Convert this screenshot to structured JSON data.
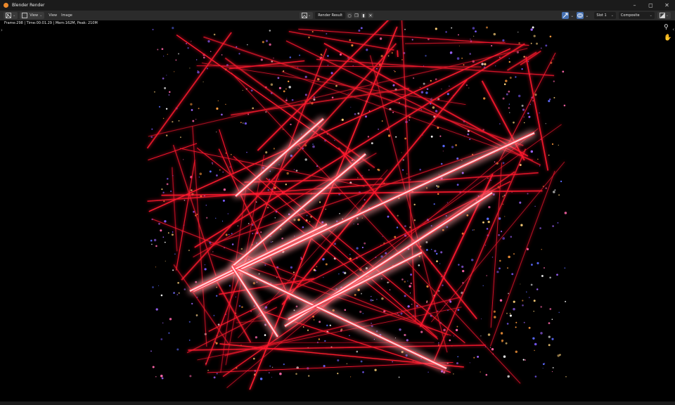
{
  "window": {
    "title": "Blender Render"
  },
  "header": {
    "view_menu": "View",
    "view_label": "View",
    "image_label": "Image",
    "result_name": "Render Result",
    "slot": "Slot 1",
    "pass": "Composite"
  },
  "viewport": {
    "info": "Frame:298 | Time:00:01.29 | Mem:162M, Peak: 210M"
  },
  "colors": {
    "laser": "#ff1a2e",
    "laser_core": "#ffd0d6",
    "header_bg": "#2b2b2b",
    "title_bg": "#1b1b1b",
    "accent_blue": "#4772b3",
    "logo_orange": "#ed8a2b"
  },
  "icons": [
    "blender-logo-icon",
    "image-editor-icon",
    "view-icon",
    "pin-icon",
    "copy-icon",
    "folder-icon",
    "close-icon",
    "gizmo-icon",
    "overlay-icon",
    "display-channels-icon",
    "zoom-icon",
    "pan-hand-icon",
    "minimize-icon",
    "maximize-icon",
    "window-close-icon"
  ]
}
